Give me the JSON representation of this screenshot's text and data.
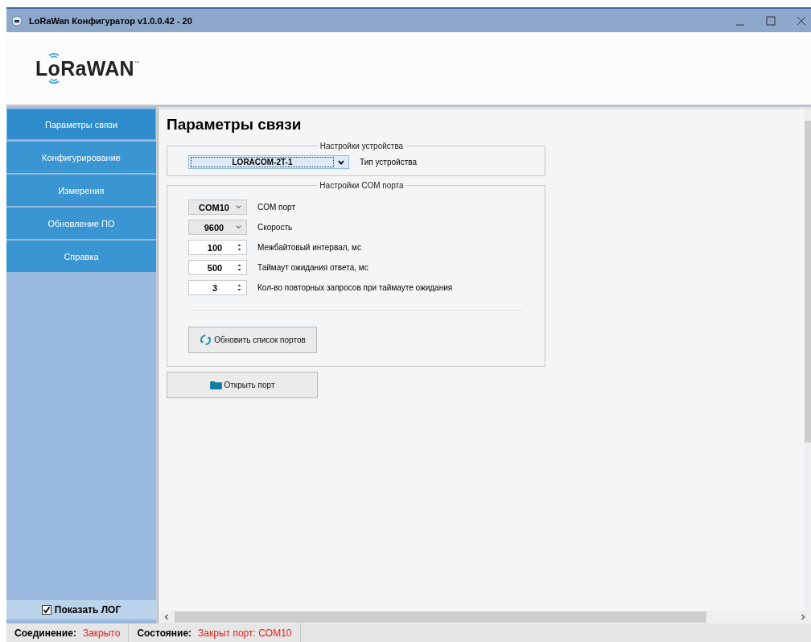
{
  "window": {
    "title": "LoRaWan Конфигуратор v1.0.0.42 - 20"
  },
  "logo": {
    "text": "LoRaWAN",
    "mark": "™"
  },
  "sidebar": {
    "items": [
      {
        "label": "Параметры связи",
        "selected": true
      },
      {
        "label": "Конфигурирование",
        "selected": false
      },
      {
        "label": "Измерения",
        "selected": false
      },
      {
        "label": "Обновление ПО",
        "selected": false
      },
      {
        "label": "Справка",
        "selected": false
      }
    ],
    "show_log": {
      "label": "Показать ЛОГ",
      "checked": true
    }
  },
  "page": {
    "title": "Параметры связи",
    "device_group": {
      "legend": "Настройки устройства",
      "device_type": {
        "value": "LORACOM-2T-1",
        "label": "Тип устройства"
      }
    },
    "port_group": {
      "legend": "Настройки COM порта",
      "fields": [
        {
          "kind": "combo",
          "value": "COM10",
          "label": "COM порт"
        },
        {
          "kind": "combo",
          "value": "9600",
          "label": "Скорость"
        },
        {
          "kind": "spin",
          "value": "100",
          "label": "Межбайтовый интервал, мс"
        },
        {
          "kind": "spin",
          "value": "500",
          "label": "Таймаут ожидания ответа, мс"
        },
        {
          "kind": "spin",
          "value": "3",
          "label": "Кол-во повторных запросов при таймауте ожидания"
        }
      ],
      "refresh_button": "Обновить список портов"
    },
    "open_button": "Открыть порт"
  },
  "status_bar": [
    {
      "label": "Соединение:",
      "value": "Закрыто"
    },
    {
      "label": "Состояние:",
      "value": "Закрыт порт: COM10"
    }
  ]
}
